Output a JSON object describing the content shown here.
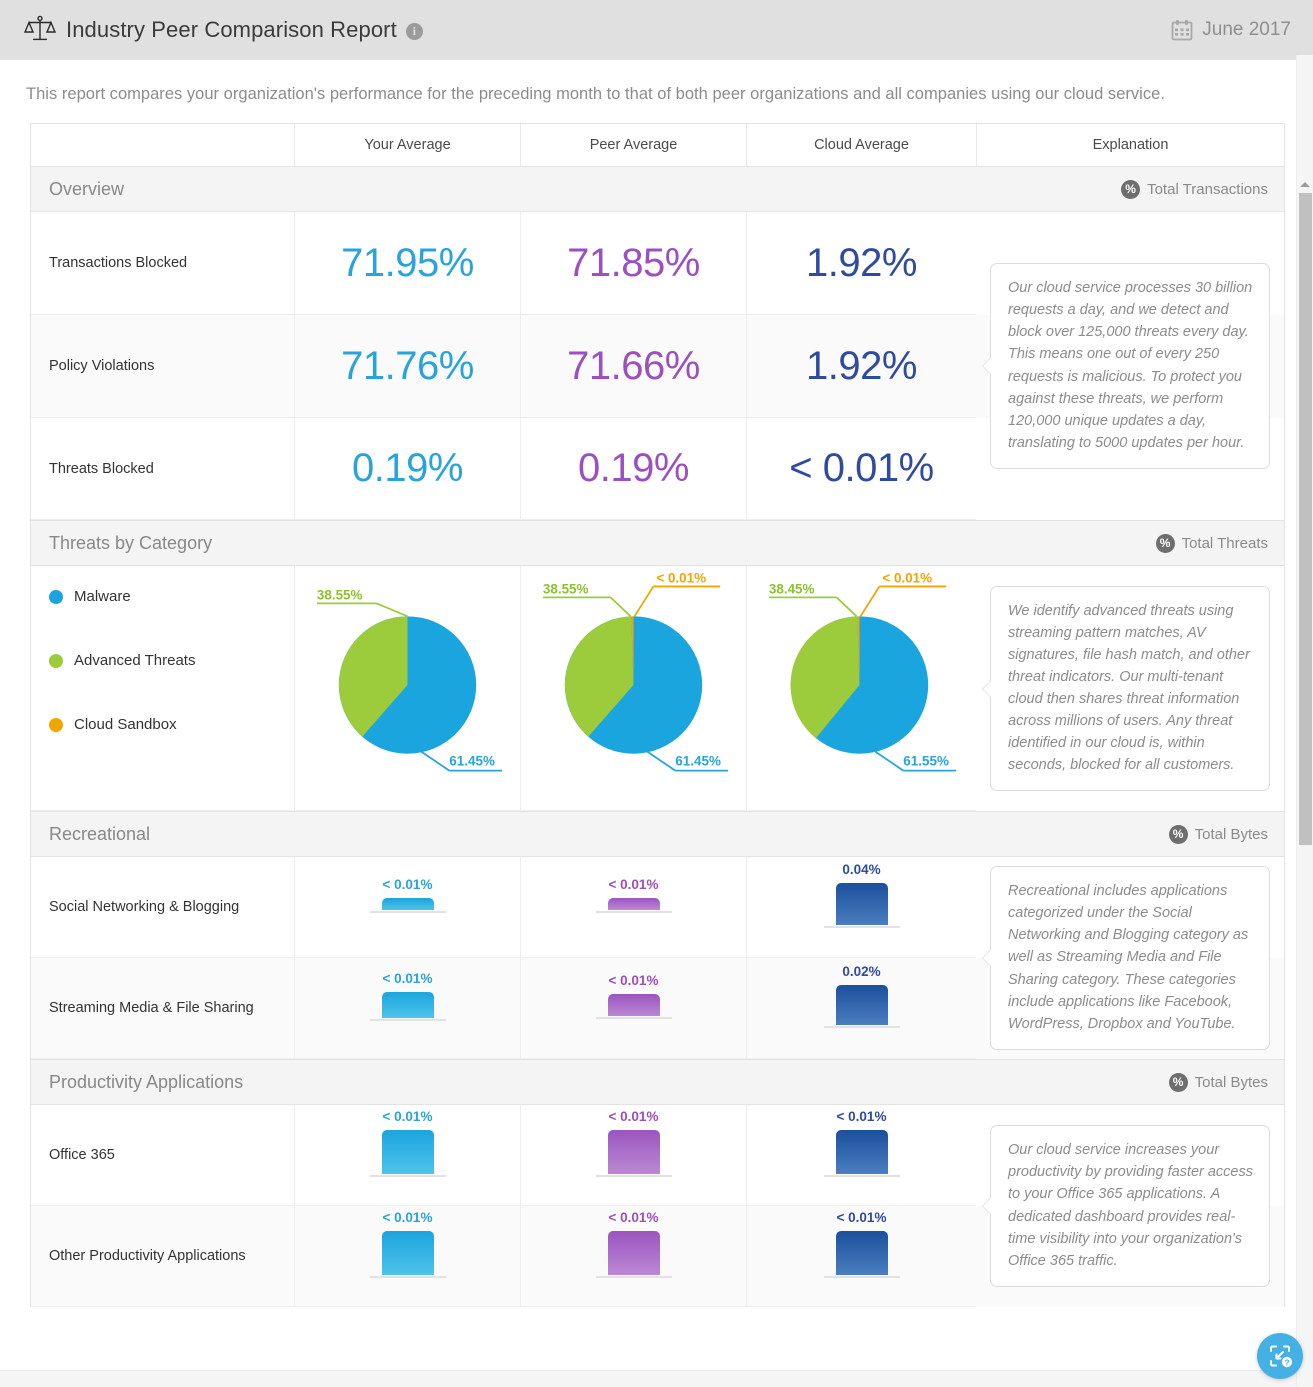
{
  "header": {
    "icon": "scale-balance-icon",
    "title": "Industry Peer Comparison Report",
    "info_glyph": "i",
    "date": "June 2017",
    "calendar_icon": "calendar-icon"
  },
  "intro": "This report compares your organization's performance for the preceding month to that of both peer organizations and all companies using our cloud service.",
  "columns": {
    "label": "",
    "your": "Your Average",
    "peer": "Peer Average",
    "cloud": "Cloud Average",
    "explanation": "Explanation"
  },
  "colors": {
    "your": "#29a3dc",
    "peer": "#9c4fc0",
    "cloud": "#2f4ba0",
    "malware": "#1ba5de",
    "advanced_threats": "#9ccb3b",
    "cloud_sandbox": "#f0a500",
    "header_bg": "#e0e0e0",
    "section_bg": "#f4f4f4"
  },
  "sections": [
    {
      "title": "Overview",
      "metric_label": "Total Transactions",
      "metric_icon": "percent-circle-icon",
      "rows": [
        {
          "label": "Transactions Blocked",
          "your": "71.95%",
          "peer": "71.85%",
          "cloud": "1.92%"
        },
        {
          "label": "Policy Violations",
          "your": "71.76%",
          "peer": "71.66%",
          "cloud": "1.92%"
        },
        {
          "label": "Threats Blocked",
          "your": "0.19%",
          "peer": "0.19%",
          "cloud": "< 0.01%"
        }
      ],
      "explanation": "Our cloud service processes 30 billion requests a day, and we detect and block over 125,000 threats every day. This means one out of every 250 requests is malicious. To protect you against these threats, we perform 120,000 unique updates a day, translating to 5000 updates per hour."
    },
    {
      "title": "Threats by Category",
      "metric_label": "Total Threats",
      "metric_icon": "percent-circle-icon",
      "legend": [
        {
          "label": "Malware",
          "color": "#1ba5de"
        },
        {
          "label": "Advanced Threats",
          "color": "#9ccb3b"
        },
        {
          "label": "Cloud Sandbox",
          "color": "#f0a500"
        }
      ],
      "explanation": "We identify advanced threats using streaming pattern matches, AV signatures, file hash match, and other threat indicators. Our multi-tenant cloud then shares threat information across millions of users. Any threat identified in our cloud is, within seconds, blocked for all customers."
    },
    {
      "title": "Recreational",
      "metric_label": "Total Bytes",
      "metric_icon": "percent-circle-icon",
      "rows": [
        {
          "label": "Social Networking & Blogging",
          "your": "< 0.01%",
          "peer": "< 0.01%",
          "cloud": "0.04%"
        },
        {
          "label": "Streaming Media & File Sharing",
          "your": "< 0.01%",
          "peer": "< 0.01%",
          "cloud": "0.02%"
        }
      ],
      "explanation": "Recreational includes applications categorized under the Social Networking and Blogging category as well as Streaming Media and File Sharing category. These categories include applications like Facebook, WordPress, Dropbox and YouTube."
    },
    {
      "title": "Productivity Applications",
      "metric_label": "Total Bytes",
      "metric_icon": "percent-circle-icon",
      "rows": [
        {
          "label": "Office 365",
          "your": "< 0.01%",
          "peer": "< 0.01%",
          "cloud": "< 0.01%"
        },
        {
          "label": "Other Productivity Applications",
          "your": "< 0.01%",
          "peer": "< 0.01%",
          "cloud": "< 0.01%"
        }
      ],
      "explanation": "Our cloud service increases your productivity by providing faster access to your Office 365 applications. A dedicated dashboard provides real-time visibility into your organization's Office 365 traffic."
    }
  ],
  "chart_data": [
    {
      "type": "pie",
      "title": "Threats by Category - Your Average",
      "labels": [
        "Malware",
        "Advanced Threats",
        "Cloud Sandbox"
      ],
      "values": [
        61.45,
        38.55,
        0.0
      ],
      "value_labels": [
        "61.45%",
        "38.55%",
        ""
      ],
      "colors": [
        "#1ba5de",
        "#9ccb3b",
        "#f0a500"
      ],
      "legend": "left"
    },
    {
      "type": "pie",
      "title": "Threats by Category - Peer Average",
      "labels": [
        "Malware",
        "Advanced Threats",
        "Cloud Sandbox"
      ],
      "values": [
        61.45,
        38.55,
        0.005
      ],
      "value_labels": [
        "61.45%",
        "38.55%",
        "< 0.01%"
      ],
      "colors": [
        "#1ba5de",
        "#9ccb3b",
        "#f0a500"
      ],
      "legend": "left"
    },
    {
      "type": "pie",
      "title": "Threats by Category - Cloud Average",
      "labels": [
        "Malware",
        "Advanced Threats",
        "Cloud Sandbox"
      ],
      "values": [
        61.55,
        38.45,
        0.005
      ],
      "value_labels": [
        "61.55%",
        "38.45%",
        "< 0.01%"
      ],
      "colors": [
        "#1ba5de",
        "#9ccb3b",
        "#f0a500"
      ],
      "legend": "left"
    },
    {
      "type": "bar",
      "title": "Recreational",
      "categories": [
        "Social Networking & Blogging",
        "Streaming Media & File Sharing"
      ],
      "series": [
        {
          "name": "Your Average",
          "values": [
            0.005,
            0.005
          ],
          "value_labels": [
            "< 0.01%",
            "< 0.01%"
          ],
          "color": "#29a3dc"
        },
        {
          "name": "Peer Average",
          "values": [
            0.005,
            0.005
          ],
          "value_labels": [
            "< 0.01%",
            "< 0.01%"
          ],
          "color": "#9c4fc0"
        },
        {
          "name": "Cloud Average",
          "values": [
            0.04,
            0.02
          ],
          "value_labels": [
            "0.04%",
            "0.02%"
          ],
          "color": "#2f4ba0"
        }
      ],
      "ylabel": "Total Bytes"
    },
    {
      "type": "bar",
      "title": "Productivity Applications",
      "categories": [
        "Office 365",
        "Other Productivity Applications"
      ],
      "series": [
        {
          "name": "Your Average",
          "values": [
            0.009,
            0.009
          ],
          "value_labels": [
            "< 0.01%",
            "< 0.01%"
          ],
          "color": "#29a3dc"
        },
        {
          "name": "Peer Average",
          "values": [
            0.009,
            0.009
          ],
          "value_labels": [
            "< 0.01%",
            "< 0.01%"
          ],
          "color": "#9c4fc0"
        },
        {
          "name": "Cloud Average",
          "values": [
            0.009,
            0.009
          ],
          "value_labels": [
            "< 0.01%",
            "< 0.01%"
          ],
          "color": "#2f4ba0"
        }
      ],
      "ylabel": "Total Bytes"
    }
  ],
  "fab": {
    "icon": "snapshot-help-icon"
  }
}
